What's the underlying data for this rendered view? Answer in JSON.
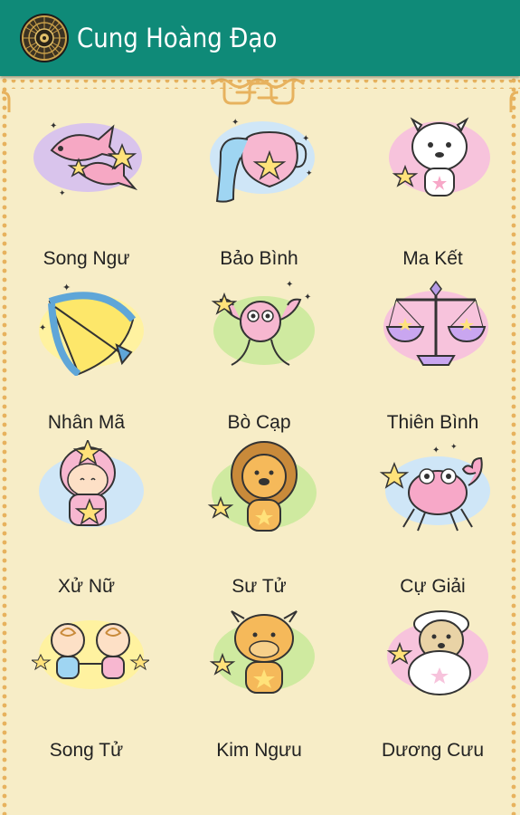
{
  "app": {
    "title": "Cung Hoàng Đạo",
    "logo_icon": "zodiac-wheel-icon"
  },
  "signs": [
    {
      "id": "song-ngu",
      "label": "Song Ngư",
      "icon": "pisces-fish-icon"
    },
    {
      "id": "bao-binh",
      "label": "Bảo Bình",
      "icon": "aquarius-jar-icon"
    },
    {
      "id": "ma-ket",
      "label": "Ma Kết",
      "icon": "capricorn-goat-icon"
    },
    {
      "id": "nhan-ma",
      "label": "Nhân Mã",
      "icon": "sagittarius-bow-icon"
    },
    {
      "id": "bo-cap",
      "label": "Bò Cạp",
      "icon": "scorpio-scorpion-icon"
    },
    {
      "id": "thien-binh",
      "label": "Thiên Bình",
      "icon": "libra-scales-icon"
    },
    {
      "id": "xu-nu",
      "label": "Xử Nữ",
      "icon": "virgo-girl-icon"
    },
    {
      "id": "su-tu",
      "label": "Sư Tử",
      "icon": "leo-lion-icon"
    },
    {
      "id": "cu-giai",
      "label": "Cự Giải",
      "icon": "cancer-crab-icon"
    },
    {
      "id": "song-tu",
      "label": "Song Tử",
      "icon": "gemini-twins-icon"
    },
    {
      "id": "kim-nguu",
      "label": "Kim Ngưu",
      "icon": "taurus-bull-icon"
    },
    {
      "id": "duong-cuu",
      "label": "Dương Cưu",
      "icon": "aries-sheep-icon"
    }
  ],
  "colors": {
    "appbar": "#0f8a78",
    "background": "#f7edc7",
    "border": "#e7b25e"
  }
}
